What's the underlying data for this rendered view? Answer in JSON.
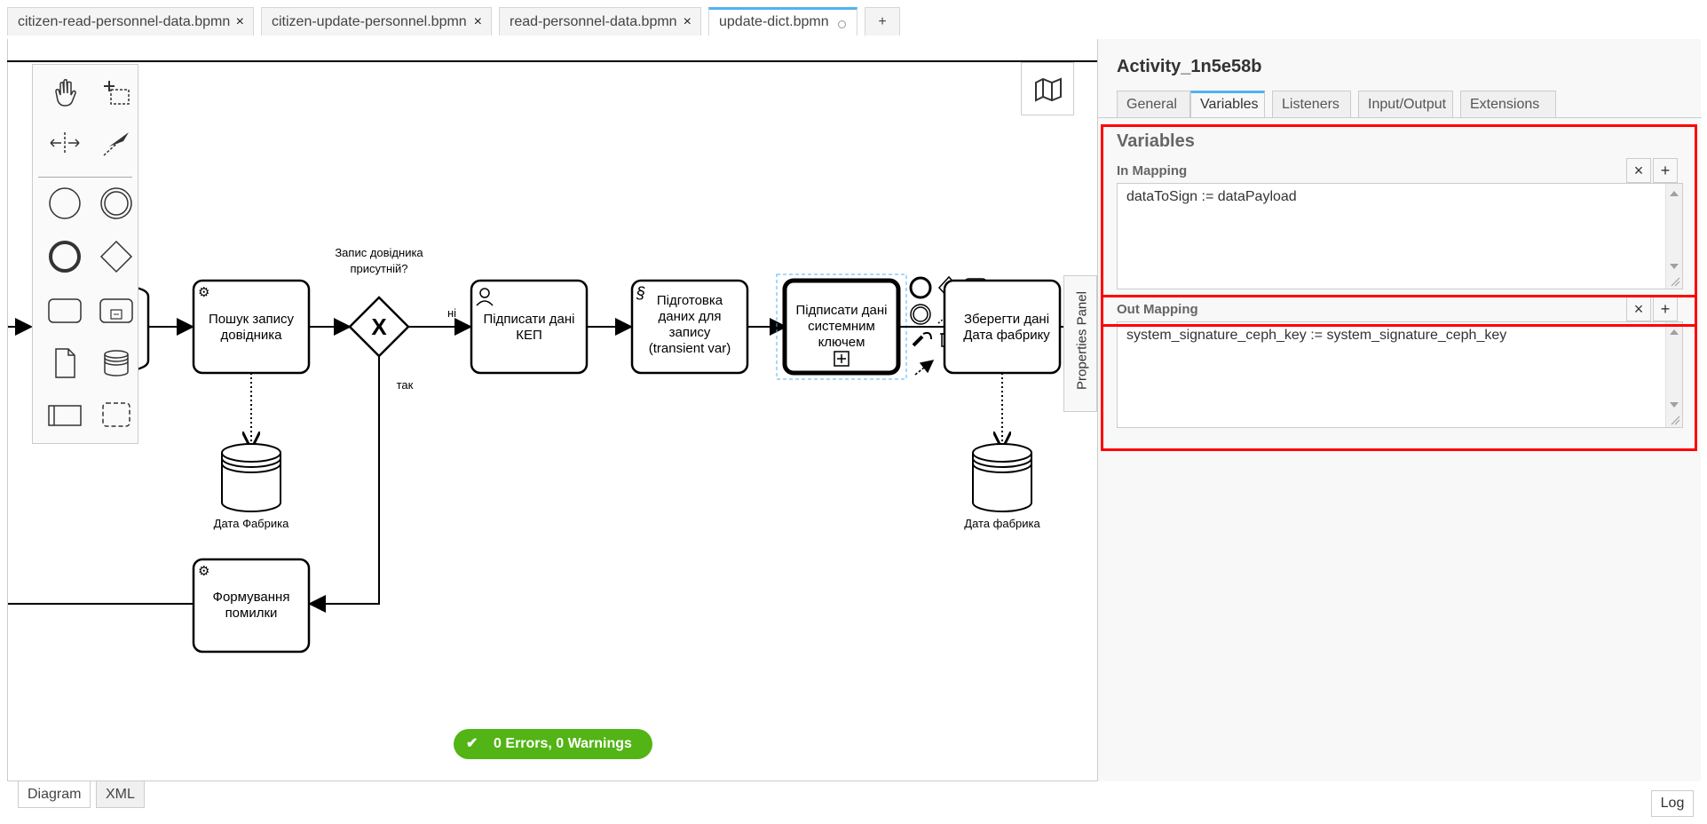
{
  "file_tabs": [
    {
      "label": "citizen-read-personnel-data.bpmn",
      "close": "×"
    },
    {
      "label": "citizen-update-personnel.bpmn",
      "close": "×"
    },
    {
      "label": "read-personnel-data.bpmn",
      "close": "×"
    },
    {
      "label": "update-dict.bpmn",
      "active": true
    },
    {
      "label": "+"
    }
  ],
  "diagram": {
    "tasks": {
      "search": "Пошук запису довідника",
      "sign_kep": "Підписати дані КЕП",
      "prepare": "Підготовка даних для запису (transient var)",
      "sign_system": "Підписати дані системним ключем",
      "save": "Зберегти дані Дата фабрику",
      "error": "Формування помилки"
    },
    "gateway_question": "Запис довідника присутній?",
    "flow_no": "ні",
    "flow_yes": "так",
    "datastore_1": "Дата Фабрика",
    "datastore_2": "Дата фабрика"
  },
  "palette": {
    "tools": [
      "hand-tool-icon",
      "lasso-tool-icon",
      "space-tool-icon",
      "global-connect-icon",
      "start-event-icon",
      "intermediate-event-icon",
      "end-event-icon",
      "gateway-icon",
      "task-icon",
      "subprocess-icon",
      "data-object-icon",
      "data-store-icon",
      "participant-icon",
      "group-icon"
    ]
  },
  "lint": {
    "label": "0 Errors, 0 Warnings",
    "color": "#52b415"
  },
  "properties_toggle": "Properties Panel",
  "properties": {
    "title": "Activity_1n5e58b",
    "tabs": [
      "General",
      "Variables",
      "Listeners",
      "Input/Output",
      "Extensions"
    ],
    "active_tab": "Variables",
    "group_title": "Variables",
    "in_mapping": {
      "label": "In Mapping",
      "value": "dataToSign := dataPayload",
      "remove": "×",
      "add": "+"
    },
    "out_mapping": {
      "label": "Out Mapping",
      "value": "system_signature_ceph_key := system_signature_ceph_key",
      "remove": "×",
      "add": "+"
    }
  },
  "bottom_tabs": [
    "Diagram",
    "XML"
  ],
  "log_button": "Log",
  "colors": {
    "accent": "#52b2f0",
    "highlight": "#ff0000",
    "success": "#52b415"
  }
}
